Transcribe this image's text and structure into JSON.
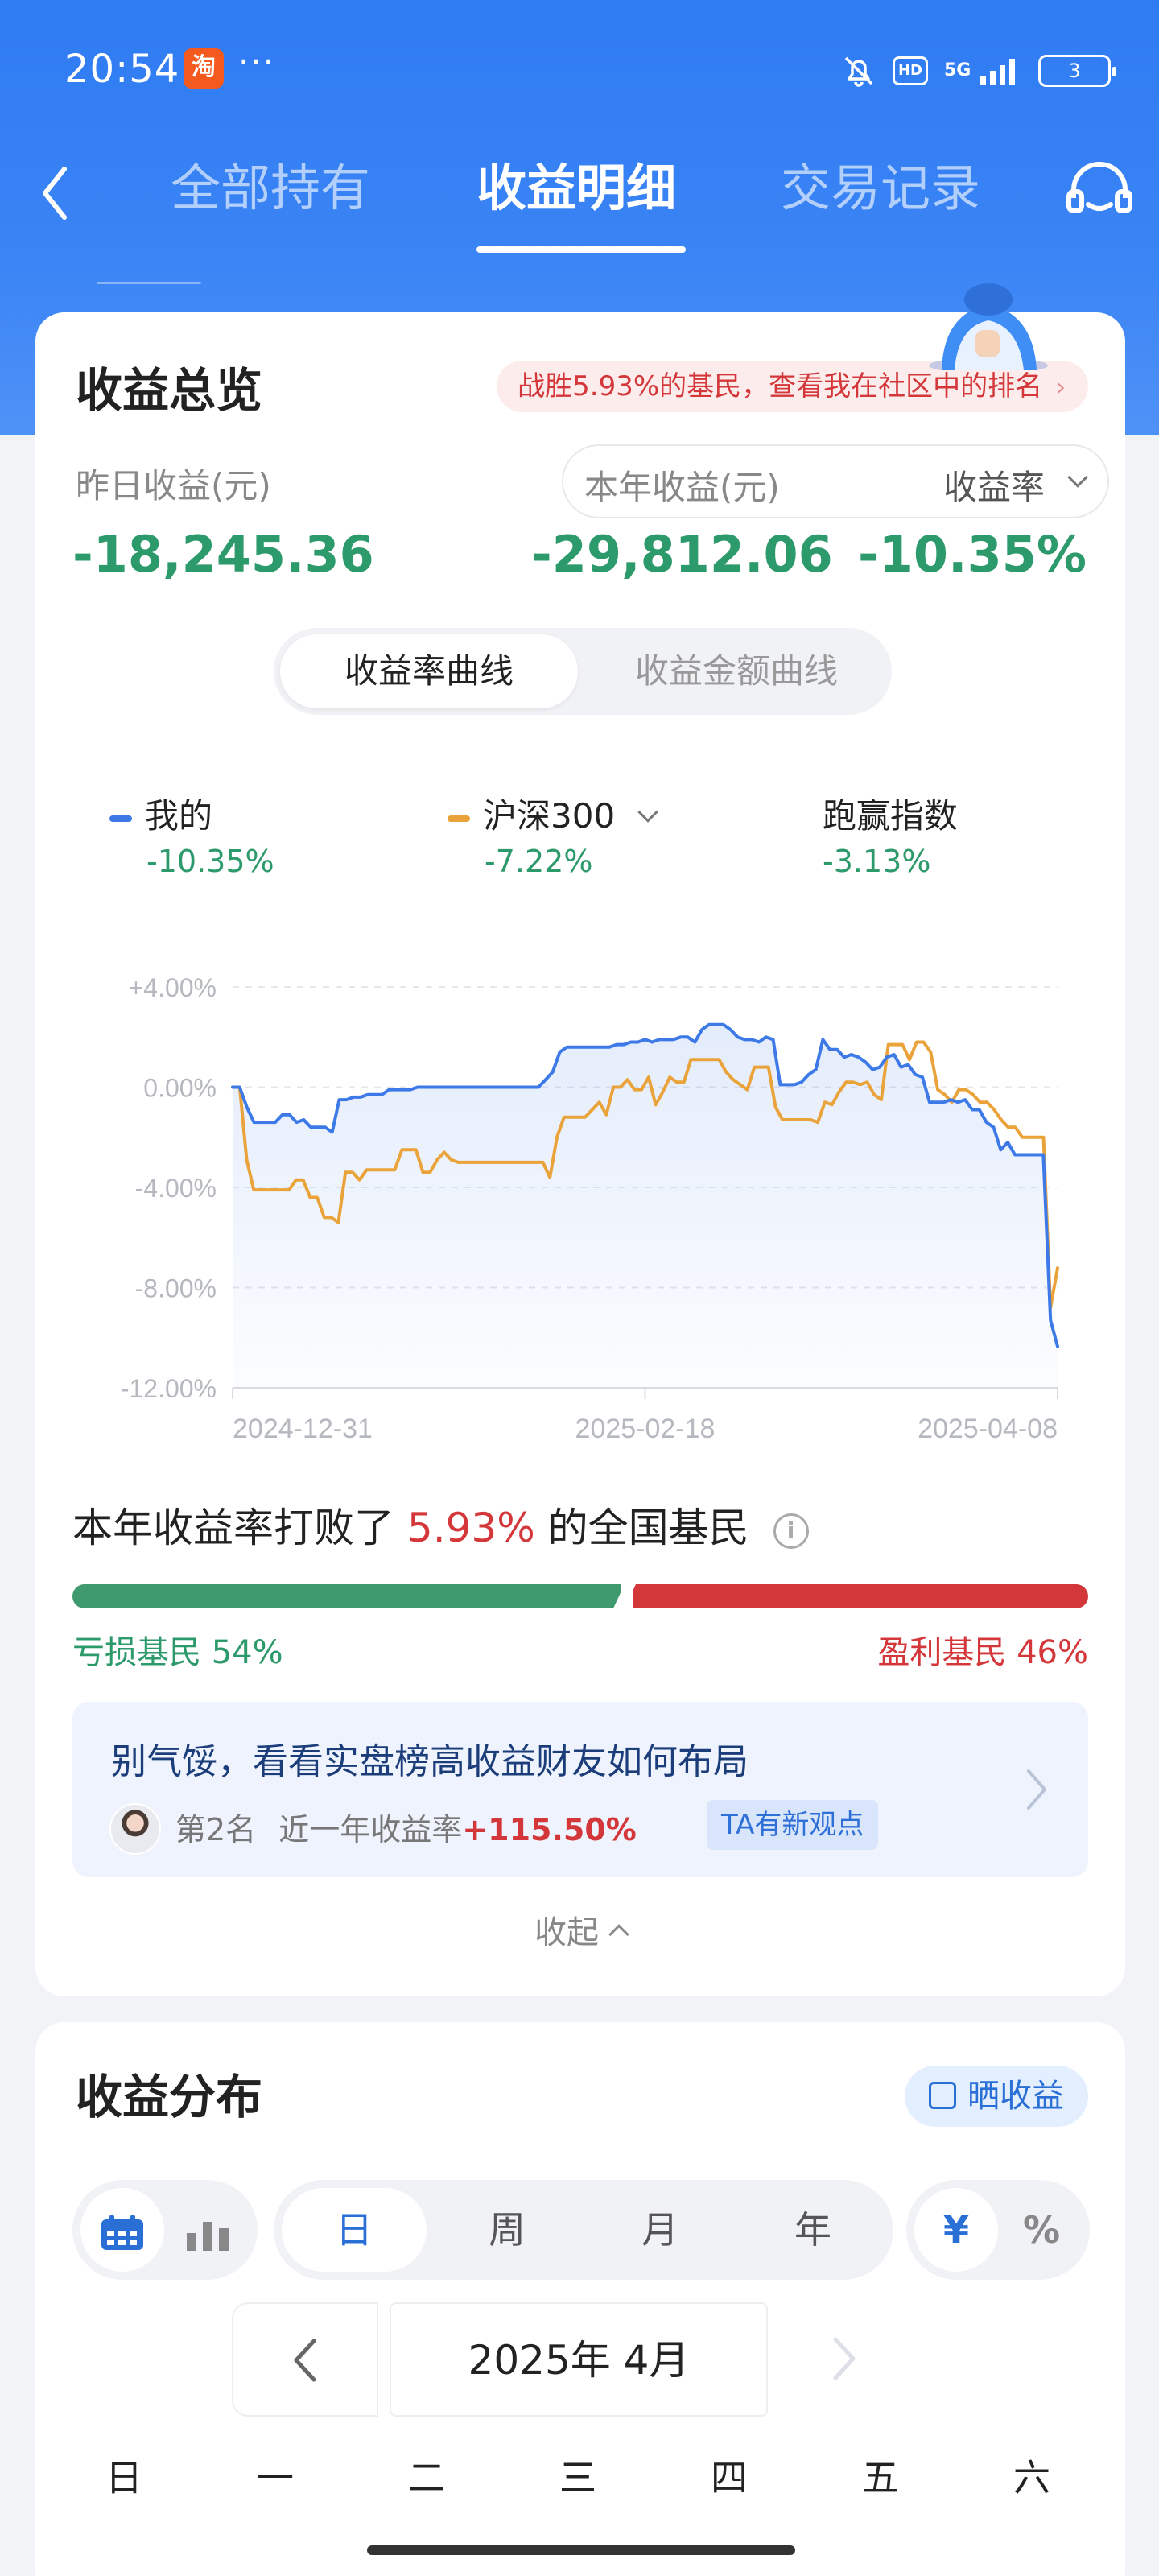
{
  "status_bar": {
    "time": "20:54",
    "app_badge": "淘",
    "dots": "···",
    "hd": "HD",
    "signal": "5G",
    "battery": "3"
  },
  "nav": {
    "tabs": [
      "全部持有",
      "收益明细",
      "交易记录"
    ],
    "active_tab": 1
  },
  "overview": {
    "title": "收益总览",
    "rank_text": "战胜5.93%的基民，查看我在社区中的排名",
    "yesterday_label": "昨日收益(元)",
    "yesterday_value": "-18,245.36",
    "year_label": "本年收益(元)",
    "rate_label": "收益率",
    "year_value": "-29,812.06",
    "rate_value": "-10.35%",
    "curve_tabs": [
      "收益率曲线",
      "收益金额曲线"
    ]
  },
  "legend": [
    {
      "name": "我的",
      "pct": "-10.35%",
      "color": "#3d7ae8"
    },
    {
      "name": "沪深300",
      "pct": "-7.22%",
      "color": "#eaa33a"
    },
    {
      "name": "跑赢指数",
      "pct": "-3.13%"
    }
  ],
  "chart_data": {
    "type": "line",
    "x_tick_labels": [
      "2024-12-31",
      "2025-02-18",
      "2025-04-08"
    ],
    "y_tick_labels": [
      "+4.00%",
      "0.00%",
      "-4.00%",
      "-8.00%",
      "-12.00%"
    ],
    "ylim": [
      -12,
      4
    ],
    "grid": true,
    "series": [
      {
        "name": "我的",
        "color": "#3d7ae8",
        "values": [
          0,
          0,
          -0.8,
          -1.4,
          -1.4,
          -1.4,
          -1.4,
          -1.1,
          -1.1,
          -1.4,
          -1.3,
          -1.6,
          -1.6,
          -1.6,
          -1.8,
          -0.5,
          -0.5,
          -0.4,
          -0.4,
          -0.3,
          -0.3,
          -0.3,
          -0.1,
          -0.1,
          -0.1,
          -0.1,
          0,
          0,
          0,
          0,
          0,
          0,
          0,
          0,
          0,
          0,
          0,
          0,
          0,
          0,
          0,
          0,
          0,
          0,
          0.3,
          0.6,
          1.4,
          1.6,
          1.6,
          1.6,
          1.6,
          1.6,
          1.6,
          1.6,
          1.7,
          1.7,
          1.8,
          1.8,
          1.9,
          1.8,
          1.9,
          1.9,
          1.9,
          2.0,
          2.0,
          1.8,
          2.3,
          2.5,
          2.5,
          2.5,
          2.3,
          2.0,
          1.9,
          1.9,
          1.8,
          2.0,
          1.9,
          0.1,
          0.1,
          0.1,
          0.2,
          0.5,
          0.7,
          1.9,
          1.5,
          1.5,
          1.2,
          1.3,
          1.2,
          1.0,
          0.7,
          0.8,
          1.2,
          1.3,
          0.8,
          0.9,
          0.5,
          0.4,
          -0.6,
          -0.6,
          -0.6,
          -0.5,
          -0.6,
          -0.5,
          -0.9,
          -0.9,
          -1.4,
          -1.6,
          -2.5,
          -2.2,
          -2.7,
          -2.7,
          -2.7,
          -2.7,
          -2.7,
          -9.3,
          -10.35
        ]
      },
      {
        "name": "沪深300",
        "color": "#eaa33a",
        "values": [
          0,
          0,
          -2.9,
          -4.1,
          -4.1,
          -4.1,
          -4.1,
          -4.1,
          -4.1,
          -3.7,
          -3.7,
          -4.4,
          -4.4,
          -5.2,
          -5.2,
          -5.4,
          -3.4,
          -3.4,
          -3.7,
          -3.3,
          -3.3,
          -3.3,
          -3.3,
          -3.3,
          -2.5,
          -2.5,
          -2.5,
          -3.4,
          -3.4,
          -2.9,
          -2.6,
          -2.9,
          -3.0,
          -3.0,
          -3.0,
          -3.0,
          -3.0,
          -3.0,
          -3.0,
          -3.0,
          -3.0,
          -3.0,
          -3.0,
          -3.0,
          -3.0,
          -3.6,
          -2.0,
          -1.2,
          -1.2,
          -1.2,
          -1.2,
          -0.9,
          -0.6,
          -1.1,
          0.0,
          0.0,
          0.3,
          -0.1,
          -0.1,
          0.4,
          -0.7,
          -0.2,
          0.4,
          0.2,
          0.2,
          1.1,
          1.1,
          1.1,
          1.1,
          1.1,
          0.6,
          0.3,
          0.1,
          -0.1,
          0.8,
          0.8,
          0.8,
          -0.8,
          -1.3,
          -1.3,
          -1.3,
          -1.3,
          -1.3,
          -1.4,
          -0.6,
          -0.7,
          -0.2,
          0.2,
          0.2,
          0.1,
          0.2,
          -0.3,
          -0.5,
          1.7,
          1.7,
          1.7,
          1.1,
          1.8,
          1.8,
          1.4,
          -0.1,
          -0.3,
          -0.6,
          -0.1,
          -0.1,
          -0.3,
          -0.6,
          -0.6,
          -0.9,
          -1.3,
          -1.6,
          -1.6,
          -2.0,
          -2.0,
          -2.0,
          -2.0,
          -8.8,
          -7.22
        ]
      }
    ]
  },
  "beat": {
    "prefix": "本年收益率打败了",
    "pct": "5.93%",
    "suffix": "的全国基民",
    "info_icon": "i"
  },
  "distribution_bar": {
    "loss_label": "亏损基民 54%",
    "win_label": "盈利基民 46%",
    "loss_share": 0.54,
    "win_share": 0.46
  },
  "promo": {
    "headline": "别气馁，看看实盘榜高收益财友如何布局",
    "rank": "第2名",
    "metric": "近一年收益率",
    "gain": "+115.50%",
    "tag": "TA有新观点"
  },
  "collapse_label": "收起",
  "distribution": {
    "title": "收益分布",
    "share_label": "晒收益",
    "periods": [
      "日",
      "周",
      "月",
      "年"
    ],
    "active_period": 0,
    "units": [
      "¥",
      "%"
    ],
    "month_label": "2025年 4月",
    "weekdays": [
      "日",
      "一",
      "二",
      "三",
      "四",
      "五",
      "六"
    ]
  },
  "colors": {
    "primary_blue": "#2f7bf2",
    "gain_red": "#d4373a",
    "loss_green": "#2d9a6b"
  }
}
